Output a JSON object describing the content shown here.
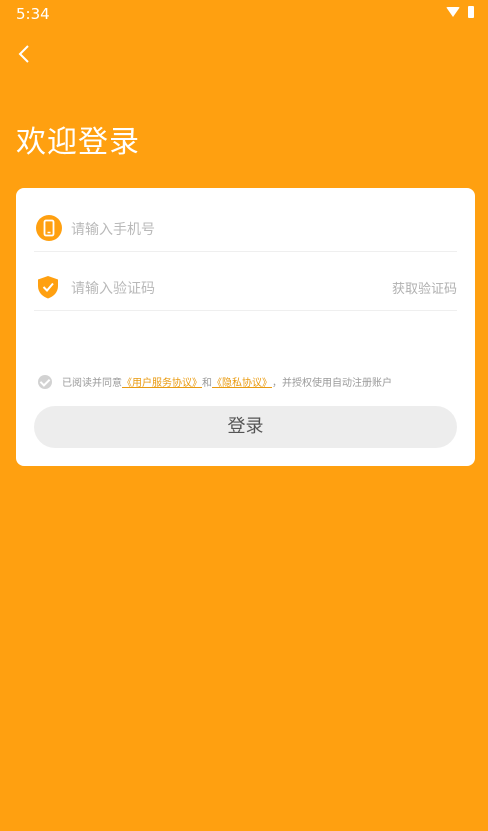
{
  "status": {
    "time": "5:34"
  },
  "icons": {
    "back": "chevron-left-icon",
    "phone": "phone-icon",
    "shield": "shield-check-icon"
  },
  "header": {
    "title": "欢迎登录"
  },
  "form": {
    "phone_placeholder": "请输入手机号",
    "code_placeholder": "请输入验证码",
    "get_code_label": "获取验证码"
  },
  "agreement": {
    "prefix": "已阅读并同意",
    "user_link": "《用户服务协议》",
    "and": "和",
    "privacy_link": "《隐私协议》",
    "suffix": "，并授权使用自动注册账户"
  },
  "login_button": "登录",
  "colors": {
    "accent": "#FFA010",
    "link": "#E99A10",
    "button_bg": "#EDEDED"
  }
}
